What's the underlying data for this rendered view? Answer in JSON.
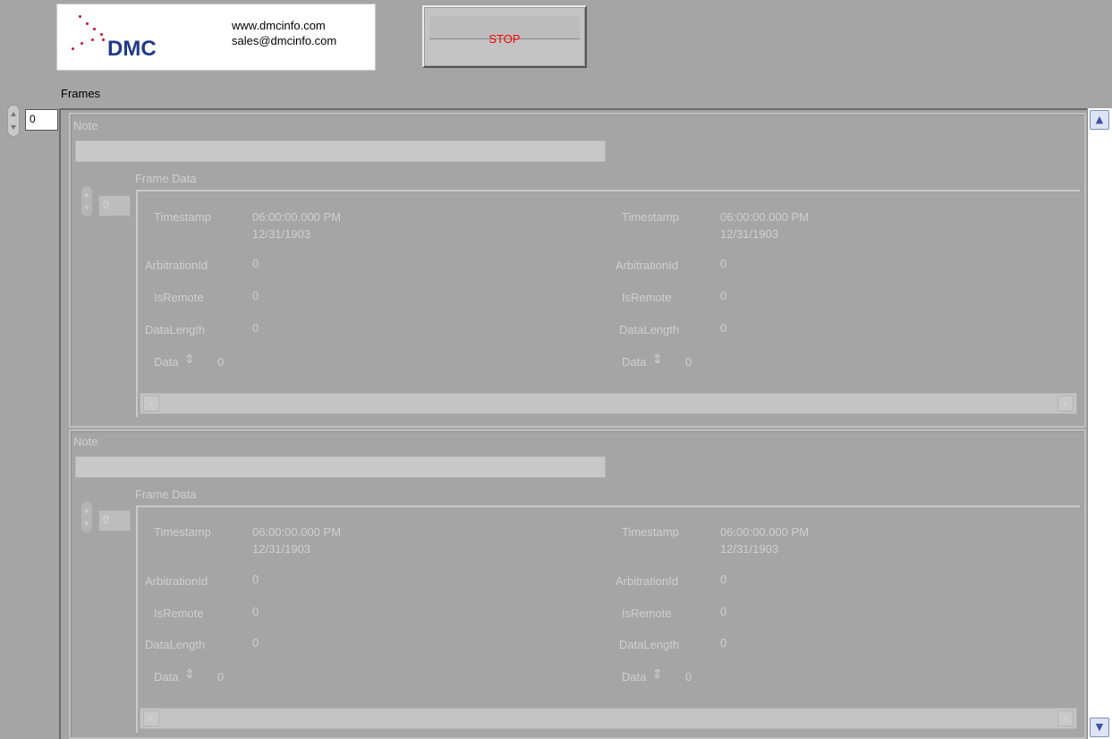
{
  "header": {
    "logo_text": "DMC",
    "website": "www.dmcinfo.com",
    "email": "sales@dmcinfo.com",
    "stop_label": "STOP",
    "stop_color": "#ff0000"
  },
  "frames": {
    "label": "Frames",
    "index": "0",
    "elements": [
      {
        "note_label": "Note",
        "note_value": "",
        "frame_data_label": "Frame Data",
        "frame_data_index": "0",
        "left": {
          "timestamp_label": "Timestamp",
          "timestamp_time": "06:00:00.000 PM",
          "timestamp_date": "12/31/1903",
          "arbitration_label": "ArbitrationId",
          "arbitration_value": "0",
          "isremote_label": "IsRemote",
          "isremote_value": "0",
          "datalength_label": "DataLength",
          "datalength_value": "0",
          "data_label": "Data",
          "data_value": "0"
        },
        "right": {
          "timestamp_label": "Timestamp",
          "timestamp_time": "06:00:00.000 PM",
          "timestamp_date": "12/31/1903",
          "arbitration_label": "ArbitrationId",
          "arbitration_value": "0",
          "isremote_label": "IsRemote",
          "isremote_value": "0",
          "datalength_label": "DataLength",
          "datalength_value": "0",
          "data_label": "Data",
          "data_value": "0"
        }
      },
      {
        "note_label": "Note",
        "note_value": "",
        "frame_data_label": "Frame Data",
        "frame_data_index": "0",
        "left": {
          "timestamp_label": "Timestamp",
          "timestamp_time": "06:00:00.000 PM",
          "timestamp_date": "12/31/1903",
          "arbitration_label": "ArbitrationId",
          "arbitration_value": "0",
          "isremote_label": "IsRemote",
          "isremote_value": "0",
          "datalength_label": "DataLength",
          "datalength_value": "0",
          "data_label": "Data",
          "data_value": "0"
        },
        "right": {
          "timestamp_label": "Timestamp",
          "timestamp_time": "06:00:00.000 PM",
          "timestamp_date": "12/31/1903",
          "arbitration_label": "ArbitrationId",
          "arbitration_value": "0",
          "isremote_label": "IsRemote",
          "isremote_value": "0",
          "datalength_label": "DataLength",
          "datalength_value": "0",
          "data_label": "Data",
          "data_value": "0"
        }
      }
    ]
  }
}
